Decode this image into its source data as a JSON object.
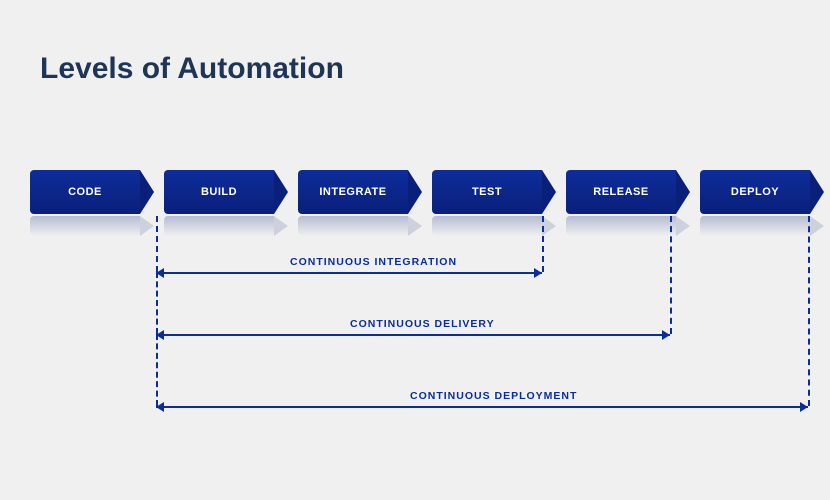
{
  "title": "Levels of Automation",
  "stages": [
    "CODE",
    "BUILD",
    "INTEGRATE",
    "TEST",
    "RELEASE",
    "DEPLOY"
  ],
  "levels": [
    {
      "name": "CONTINUOUS   INTEGRATION",
      "from": "BUILD",
      "to": "TEST"
    },
    {
      "name": "CONTINUOUS   DELIVERY",
      "from": "BUILD",
      "to": "RELEASE"
    },
    {
      "name": "CONTINUOUS   DEPLOYMENT",
      "from": "BUILD",
      "to": "DEPLOY"
    }
  ],
  "colors": {
    "stage_bg": "#0a1f7a",
    "line": "#0a2d9c",
    "title": "#1e3556",
    "page_bg": "#f0f0f0"
  }
}
